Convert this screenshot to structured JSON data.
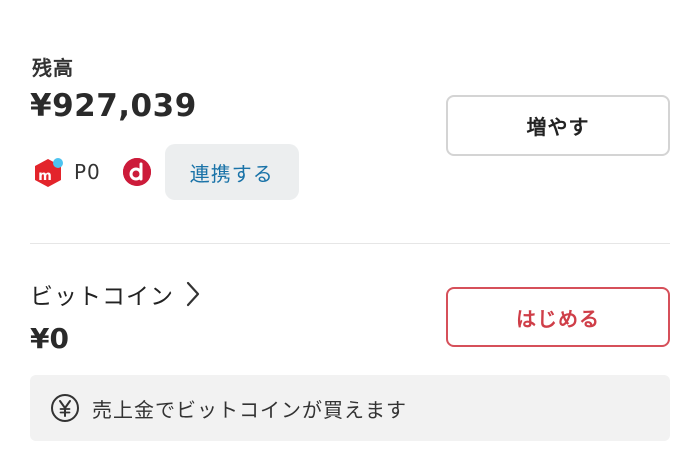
{
  "balance": {
    "label": "残高",
    "amount": "¥927,039",
    "increase_button_label": "増やす"
  },
  "points": {
    "merpay_points": "P0",
    "link_button_label": "連携する",
    "icons": [
      "merpay-icon",
      "d-point-icon"
    ]
  },
  "bitcoin": {
    "title": "ビットコイン",
    "amount": "¥0",
    "start_button_label": "はじめる",
    "info_text": "売上金でビットコインが買えます"
  },
  "colors": {
    "merpay_red": "#e3242b",
    "merpay_accent": "#4dc3f0",
    "dpoint_red": "#cc1b3a",
    "link_blue": "#1a73a8",
    "start_red": "#cf3e48",
    "banner_bg": "#f2f2f2"
  }
}
